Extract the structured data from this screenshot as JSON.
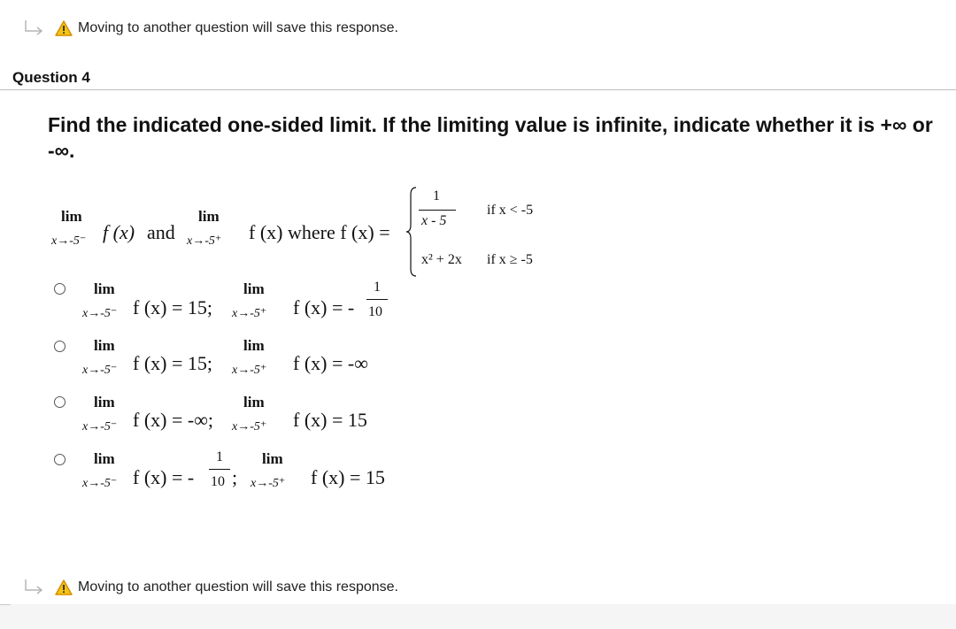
{
  "warning_text": "Moving to another question will save this response.",
  "question_title": "Question 4",
  "prompt": "Find the indicated one-sided limit. If the limiting value is infinite, indicate whether it is +∞ or -∞.",
  "problem": {
    "lim": "lim",
    "left_sub": "x→-5⁻",
    "right_sub": "x→-5⁺",
    "fx": "f (x)",
    "and": "and",
    "where_fx": "f (x) where f (x) =",
    "piece1_num": "1",
    "piece1_den": "x - 5",
    "piece1_cond": "if x < -5",
    "piece2_expr": "x² + 2x",
    "piece2_cond": "if x ≥ -5"
  },
  "options": [
    {
      "left_expr": "f (x) = 15;",
      "right_expr": "f (x) = -",
      "right_frac_num": "1",
      "right_frac_den": "10"
    },
    {
      "left_expr": "f (x) = 15;",
      "right_expr": "f (x) = -∞"
    },
    {
      "left_expr": "f (x) = -∞;",
      "right_expr": "f (x) = 15"
    },
    {
      "left_expr": "f (x) = -",
      "left_frac_num": "1",
      "left_frac_den": "10",
      "left_sep": ";",
      "right_expr": "f (x) = 15"
    }
  ],
  "icons": {
    "warning": "warning-triangle-icon",
    "arrow": "return-arrow-icon",
    "radio": "radio-button"
  },
  "colors": {
    "warning_yellow": "#f2c414",
    "warning_outline": "#d98b00",
    "rule": "#bdbdbd"
  }
}
